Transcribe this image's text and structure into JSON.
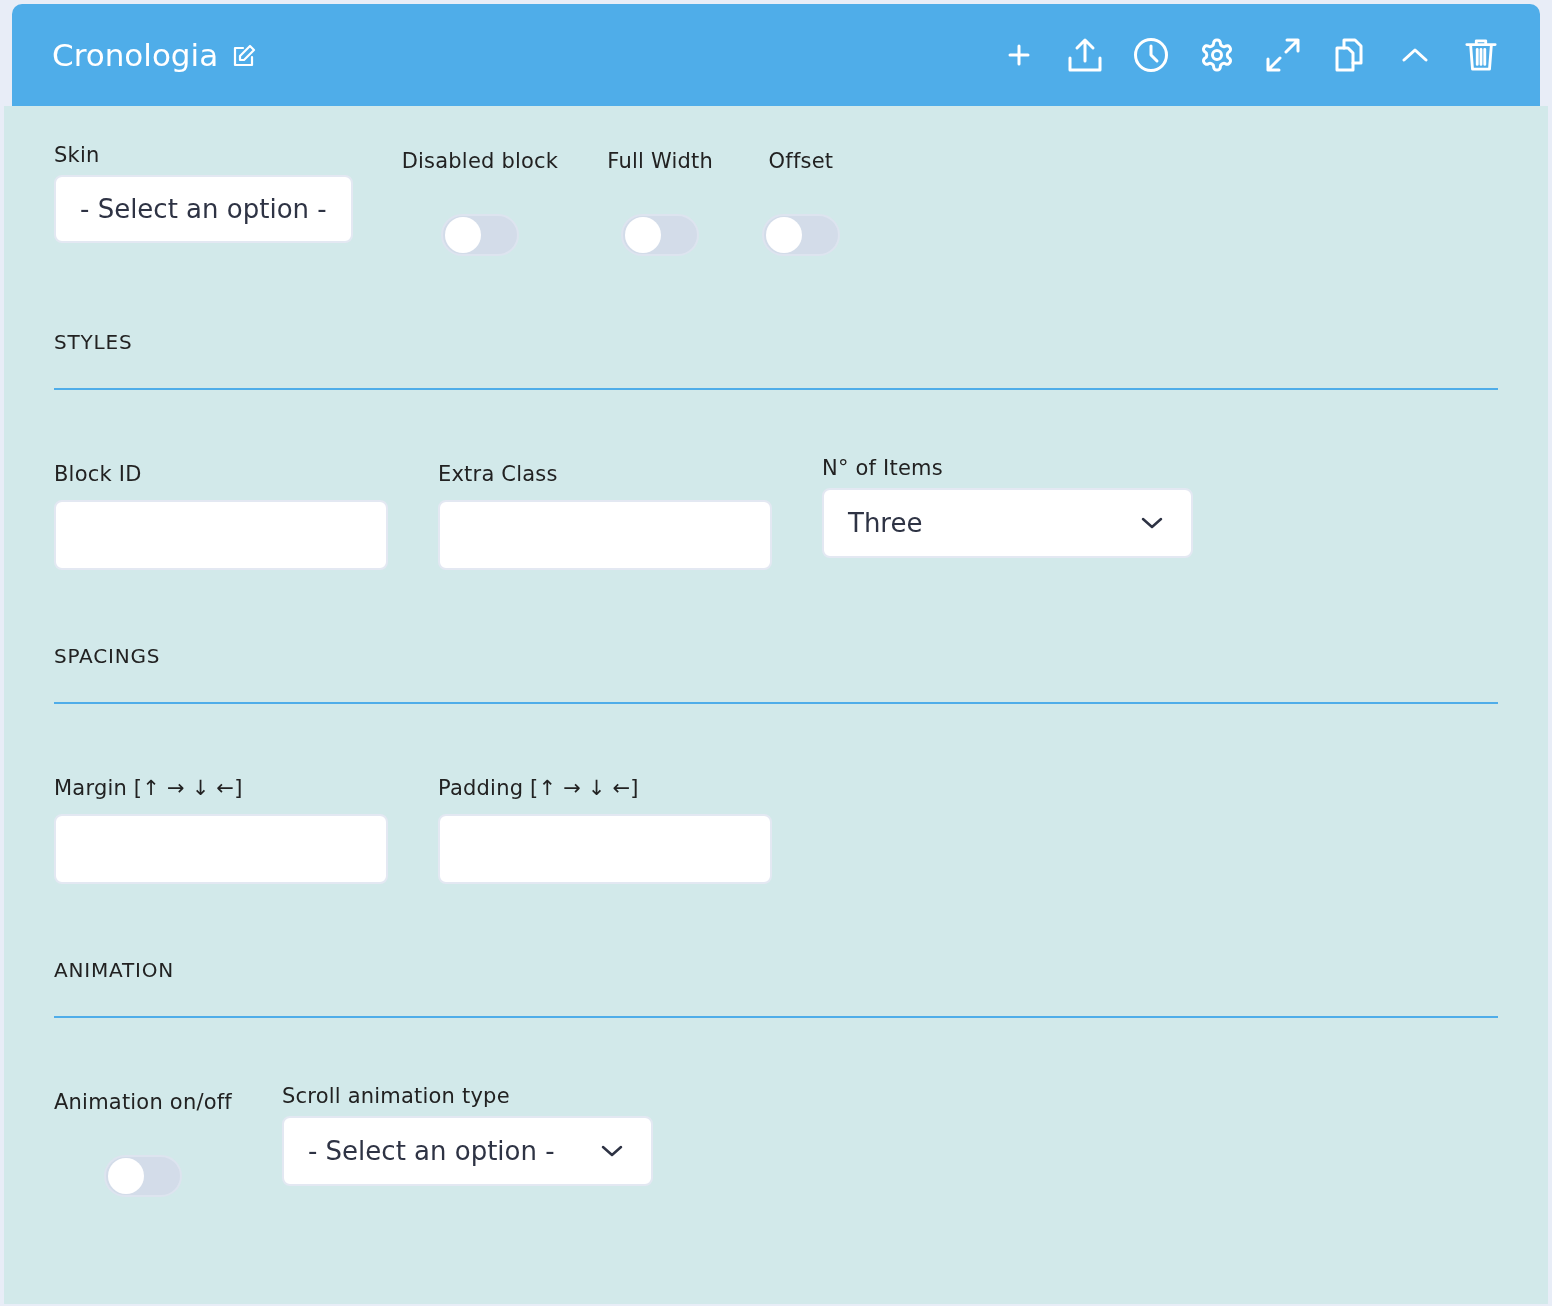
{
  "header": {
    "title": "Cronologia"
  },
  "general": {
    "fields": [
      {
        "kind": "choice",
        "label": "Skin",
        "value": "- Select an option -"
      },
      {
        "kind": "toggle",
        "label": "Disabled block",
        "on": false
      },
      {
        "kind": "toggle",
        "label": "Full Width",
        "on": false
      },
      {
        "kind": "toggle",
        "label": "Offset",
        "on": false
      }
    ]
  },
  "sections": [
    {
      "title": "STYLES",
      "fields": [
        {
          "kind": "text",
          "label": "Block ID"
        },
        {
          "kind": "text",
          "label": "Extra Class"
        },
        {
          "kind": "dropdown",
          "label": "N° of Items",
          "value": "Three"
        }
      ]
    },
    {
      "title": "SPACINGS",
      "fields": [
        {
          "kind": "text",
          "label": "Margin [↑ → ↓ ←]"
        },
        {
          "kind": "text",
          "label": "Padding [↑ → ↓ ←]"
        }
      ]
    },
    {
      "title": "ANIMATION",
      "fields": [
        {
          "kind": "toggle",
          "label": "Animation on/off",
          "on": false
        },
        {
          "kind": "dropdown",
          "label": "Scroll animation type",
          "value": "- Select an option -"
        }
      ]
    }
  ]
}
